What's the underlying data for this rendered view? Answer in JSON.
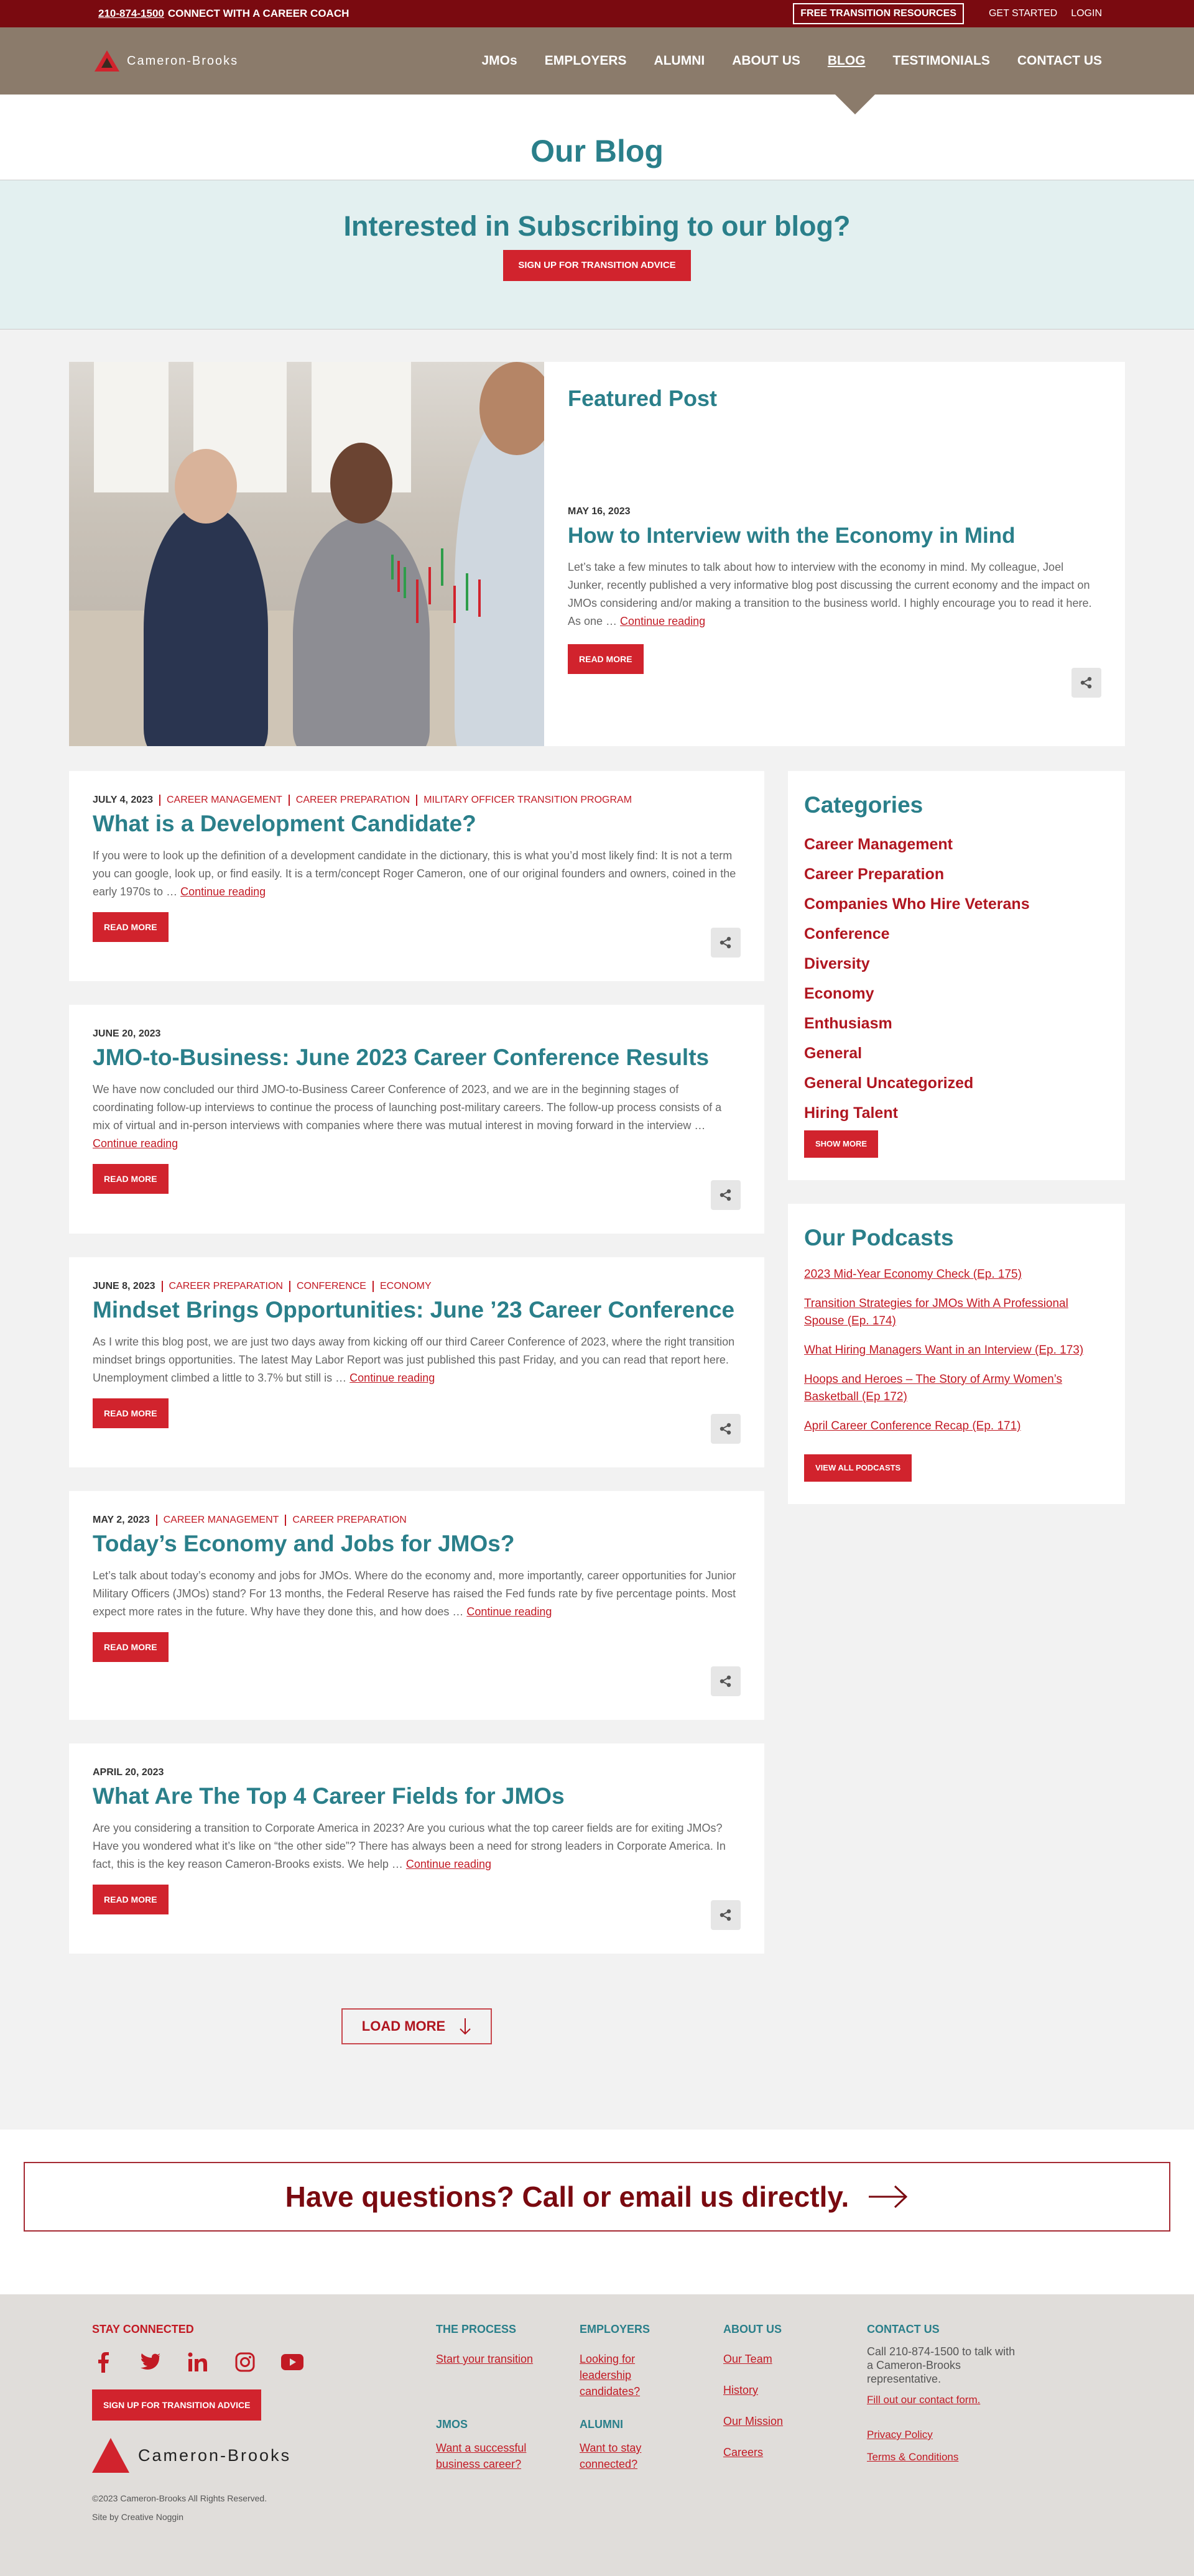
{
  "topbar": {
    "phone": "210-874-1500",
    "coach_text": "CONNECT WITH A CAREER COACH",
    "resources_button": "FREE TRANSITION RESOURCES",
    "get_started": "GET STARTED",
    "login": "LOGIN"
  },
  "nav": {
    "logo_text": "Cameron-Brooks",
    "items": [
      "JMOs",
      "EMPLOYERS",
      "ALUMNI",
      "ABOUT US",
      "BLOG",
      "TESTIMONIALS",
      "CONTACT US"
    ]
  },
  "page": {
    "title": "Our Blog",
    "subscribe_heading": "Interested in Subscribing to our blog?",
    "subscribe_button": "SIGN UP FOR TRANSITION ADVICE"
  },
  "featured": {
    "label": "Featured Post",
    "date": "MAY 16, 2023",
    "title": "How to Interview with the Economy in Mind",
    "excerpt": "Let’s take a few minutes to talk about how to interview with the economy in mind. My colleague, Joel Junker, recently published a very informative blog post discussing the current economy and the impact on JMOs considering and/or making a transition to the business world. I highly encourage you to read it here. As one … ",
    "continue": "Continue reading",
    "read_more": "READ MORE"
  },
  "posts": [
    {
      "date": "JULY 4, 2023",
      "categories": [
        "CAREER MANAGEMENT",
        "CAREER PREPARATION",
        "MILITARY OFFICER TRANSITION PROGRAM"
      ],
      "title": "What is a Development Candidate?",
      "excerpt": "If you were to look up the definition of a development candidate in the dictionary, this is what you’d most likely find: It is not a term you can google, look up, or find easily.  It is a term/concept Roger Cameron, one of our original founders and owners, coined in the early 1970s to … ",
      "continue": "Continue reading",
      "read_more": "READ MORE"
    },
    {
      "date": "JUNE 20, 2023",
      "categories": [],
      "title": "JMO-to-Business: June 2023 Career Conference Results",
      "excerpt": "We have now concluded our third JMO-to-Business Career Conference of 2023, and we are in the beginning stages of coordinating follow-up interviews to continue the process of launching post-military careers.  The follow-up process consists of a mix of virtual and in-person interviews with companies where there was mutual interest in moving forward in the interview … ",
      "continue": "Continue reading",
      "read_more": "READ MORE"
    },
    {
      "date": "JUNE 8, 2023",
      "categories": [
        "CAREER PREPARATION",
        "CONFERENCE",
        "ECONOMY"
      ],
      "title": "Mindset Brings Opportunities: June ’23 Career Conference",
      "excerpt": "As I write this blog post, we are just two days away from kicking off our third Career Conference of 2023, where the right transition mindset brings opportunities. The latest May Labor Report was just published this past Friday, and you can read that report here.  Unemployment climbed a little to 3.7% but still is … ",
      "continue": "Continue reading",
      "read_more": "READ MORE"
    },
    {
      "date": "MAY 2, 2023",
      "categories": [
        "CAREER MANAGEMENT",
        "CAREER PREPARATION"
      ],
      "title": "Today’s Economy and Jobs for JMOs?",
      "excerpt": "Let’s talk about today’s economy and jobs for JMOs. Where do the economy and, more importantly, career opportunities for Junior Military Officers (JMOs) stand? For 13 months, the Federal Reserve has raised the Fed funds rate by five percentage points. Most expect more rates in the future. Why have they done this, and how does … ",
      "continue": "Continue reading",
      "read_more": "READ MORE"
    },
    {
      "date": "APRIL 20, 2023",
      "categories": [],
      "title": "What Are The Top 4 Career Fields for JMOs",
      "excerpt": "Are you considering a transition to Corporate America in 2023? Are you curious what the top career fields are for exiting JMOs? Have you wondered what it’s like on “the other side”? There has always been a need for strong leaders in Corporate America. In fact, this is the key reason Cameron-Brooks exists. We help … ",
      "continue": "Continue reading",
      "read_more": "READ MORE"
    }
  ],
  "sidebar": {
    "categories_title": "Categories",
    "categories": [
      "Career Management",
      "Career Preparation",
      "Companies Who Hire Veterans",
      "Conference",
      "Diversity",
      "Economy",
      "Enthusiasm",
      "General",
      "General Uncategorized",
      "Hiring Talent"
    ],
    "show_more": "SHOW MORE",
    "podcasts_title": "Our Podcasts",
    "podcasts": [
      "2023 Mid-Year Economy Check (Ep. 175)",
      "Transition Strategies for JMOs With A Professional Spouse (Ep. 174)",
      "What Hiring Managers Want in an Interview (Ep. 173)",
      "Hoops and Heroes – The Story of Army Women’s Basketball (Ep 172)",
      "April Career Conference Recap (Ep. 171)"
    ],
    "view_all": "VIEW ALL PODCASTS"
  },
  "load_more": "LOAD MORE",
  "cta": {
    "text": "Have questions? Call or email us directly."
  },
  "footer": {
    "stay_connected": "STAY CONNECTED",
    "social_icons": [
      "facebook-icon",
      "twitter-icon",
      "linkedin-icon",
      "instagram-icon",
      "youtube-icon"
    ],
    "signup_button": "SIGN UP FOR TRANSITION ADVICE",
    "logo_text": "Cameron-Brooks",
    "copyright": "©2023 Cameron-Brooks All Rights Reserved.",
    "credit": "Site by Creative Noggin",
    "process_head": "THE PROCESS",
    "process_link": "Start your transition",
    "jmos_head": "JMOS",
    "jmos_link": "Want a successful business career?",
    "employers_head": "EMPLOYERS",
    "employers_link": "Looking for leadership candidates?",
    "alumni_head": "ALUMNI",
    "alumni_link": "Want to stay connected?",
    "about_head": "ABOUT US",
    "about_links": [
      "Our Team",
      "History",
      "Our Mission",
      "Careers"
    ],
    "contact_head": "CONTACT US",
    "contact_text": "Call 210-874-1500 to talk with a Cameron-Brooks representative.",
    "contact_form": "Fill out our contact form.",
    "privacy": "Privacy Policy",
    "terms": "Terms & Conditions"
  },
  "colors": {
    "brand_red": "#d1232d",
    "dark_red": "#7a0a10",
    "teal": "#2a7f8a",
    "nav_brown": "#8b7b6b"
  }
}
